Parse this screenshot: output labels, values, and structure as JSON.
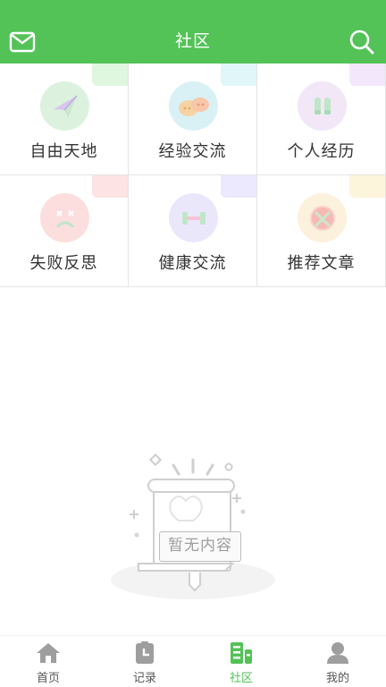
{
  "header": {
    "title": "社区",
    "left_icon": "mail-icon",
    "right_icon": "search-icon",
    "color": "#53c257"
  },
  "categories": [
    {
      "label": "自由天地",
      "icon": "paper-plane-icon",
      "bg": "#e7f6e9",
      "corner": "#dff6df"
    },
    {
      "label": "经验交流",
      "icon": "chat-bubbles-icon",
      "bg": "#e1f3f7",
      "corner": "#e1f6f8"
    },
    {
      "label": "个人经历",
      "icon": "footprints-icon",
      "bg": "#f4ecf8",
      "corner": "#f3e8fb"
    },
    {
      "label": "失败反思",
      "icon": "sad-face-icon",
      "bg": "#fde5e5",
      "corner": "#fde3e3"
    },
    {
      "label": "健康交流",
      "icon": "dumbbell-icon",
      "bg": "#efecfb",
      "corner": "#ece8fd"
    },
    {
      "label": "推荐文章",
      "icon": "book-icon",
      "bg": "#fdf3e1",
      "corner": "#fdf4dc"
    }
  ],
  "empty_state": {
    "text": "暂无内容",
    "icon": "empty-scroll-icon"
  },
  "tabbar": {
    "active_color": "#53c257",
    "items": [
      {
        "label": "首页",
        "icon": "home-icon"
      },
      {
        "label": "记录",
        "icon": "record-icon"
      },
      {
        "label": "社区",
        "icon": "community-icon"
      },
      {
        "label": "我的",
        "icon": "profile-icon"
      }
    ]
  }
}
